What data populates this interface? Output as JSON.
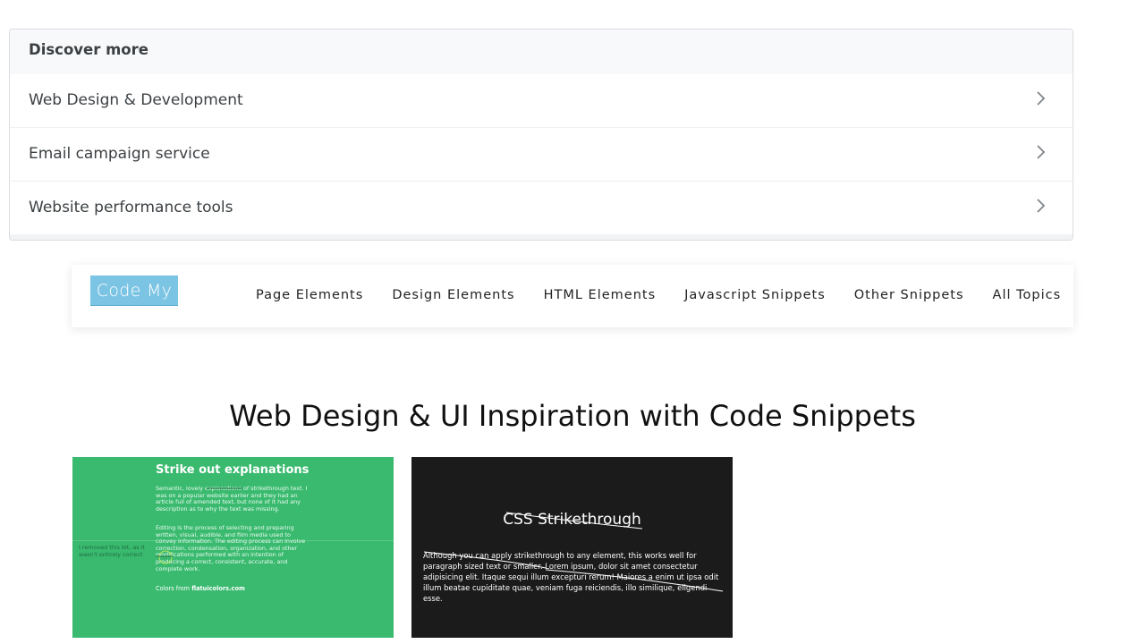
{
  "discover": {
    "heading": "Discover more",
    "items": [
      {
        "label": "Web Design & Development"
      },
      {
        "label": "Email campaign service"
      },
      {
        "label": "Website performance tools"
      }
    ]
  },
  "nav": {
    "logo": "Code My UI",
    "links": [
      {
        "label": "Page Elements"
      },
      {
        "label": "Design Elements"
      },
      {
        "label": "HTML Elements"
      },
      {
        "label": "Javascript Snippets"
      },
      {
        "label": "Other Snippets"
      },
      {
        "label": "All Topics"
      }
    ]
  },
  "main": {
    "title": "Web Design & UI Inspiration with Code Snippets"
  },
  "cards": [
    {
      "title": "Strike out explanations",
      "para1": "Semantic, lovely explanations of strikethrough text. I was on a popular website earlier and they had an article full of amended text, but none of it had any description as to why the text was missing.",
      "para2": "Editing is the process of selecting and preparing written, visual, audible, and film media used to convey information. The editing process can involve correction, condensation, organization, and other modifications performed with an intention of producing a correct, consistent, accurate, and complete work.",
      "side_note": "I removed this bit, as it wasn't entirely correct",
      "colors_prefix": "Colors from ",
      "colors_source": "flatuicolors.com",
      "bg_color": "#3aba6f"
    },
    {
      "title": "CSS Strikethrough",
      "para": "Although you can apply strikethrough to any element, this works well for paragraph sized text or smaller. Lorem ipsum, dolor sit amet consectetur adipisicing elit. Itaque sequi illum excepturi rerum! Maiores a enim ut ipsa odit illum beatae cupiditate quae, veniam fuga reiciendis, illo similique, eligendi esse.",
      "bg_color": "#1b1b1b"
    }
  ]
}
